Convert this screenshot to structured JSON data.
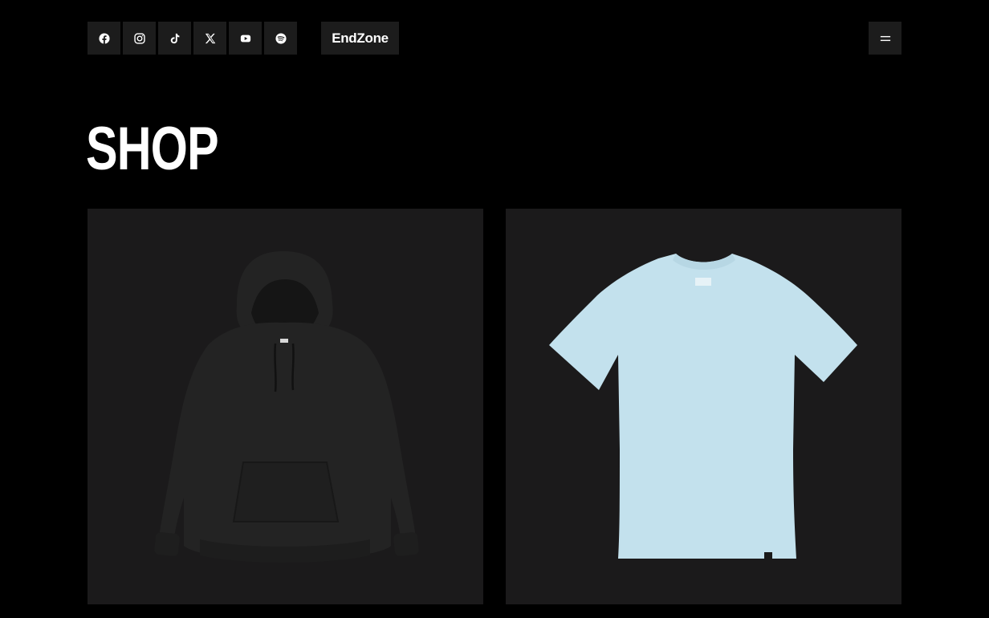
{
  "header": {
    "social_icons": [
      "facebook-icon",
      "instagram-icon",
      "tiktok-icon",
      "x-icon",
      "youtube-icon",
      "spotify-icon"
    ],
    "logo_text": "EndZone",
    "menu_icon": "menu-icon"
  },
  "main": {
    "title": "SHOP",
    "products": [
      {
        "image": "black-hoodie",
        "color": "#232323"
      },
      {
        "image": "light-blue-tshirt",
        "color": "#c3e1ed"
      }
    ]
  },
  "colors": {
    "background": "#000000",
    "button_bg": "#1c1c1c",
    "card_bg": "#1b1a1b",
    "text": "#ffffff"
  }
}
